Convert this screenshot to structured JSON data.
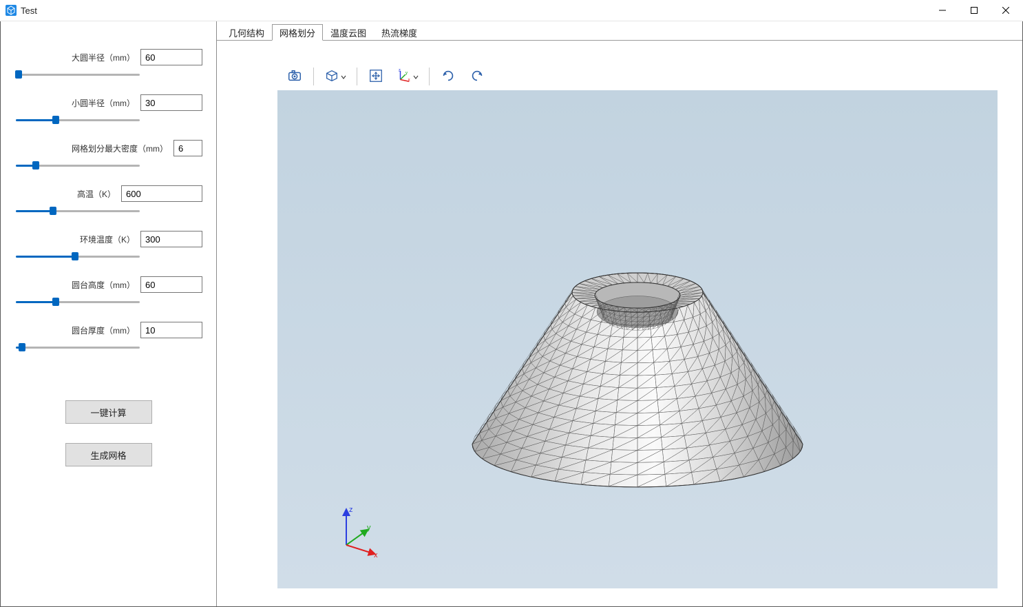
{
  "window": {
    "title": "Test"
  },
  "params": [
    {
      "label": "大圆半径（mm）",
      "value": "60",
      "input_w": "w90",
      "slider_pct": 2,
      "slider_w": 180
    },
    {
      "label": "小圆半径（mm）",
      "value": "30",
      "input_w": "w90",
      "slider_pct": 32,
      "slider_w": 180
    },
    {
      "label": "网格划分最大密度（mm）",
      "value": "6",
      "input_w": "w42",
      "slider_pct": 16,
      "slider_w": 180
    },
    {
      "label": "高温（K）",
      "value": "600",
      "input_w": "w118",
      "slider_pct": 30,
      "slider_w": 180
    },
    {
      "label": "环境温度（K）",
      "value": "300",
      "input_w": "w90",
      "slider_pct": 48,
      "slider_w": 180
    },
    {
      "label": "圆台高度（mm）",
      "value": "60",
      "input_w": "w90",
      "slider_pct": 32,
      "slider_w": 180
    },
    {
      "label": "圆台厚度（mm）",
      "value": "10",
      "input_w": "w90",
      "slider_pct": 5,
      "slider_w": 180
    }
  ],
  "actions": {
    "compute": "一键计算",
    "generate_mesh": "生成网格"
  },
  "tabs": [
    {
      "label": "几何结构",
      "active": false
    },
    {
      "label": "网格划分",
      "active": true
    },
    {
      "label": "温度云图",
      "active": false
    },
    {
      "label": "热流梯度",
      "active": false
    }
  ],
  "toolbar": {
    "items": [
      {
        "name": "camera-icon"
      },
      {
        "name": "sep"
      },
      {
        "name": "cube-icon",
        "dropdown": true
      },
      {
        "name": "sep"
      },
      {
        "name": "fit-icon"
      },
      {
        "name": "axes-icon",
        "dropdown": true
      },
      {
        "name": "sep"
      },
      {
        "name": "rotate-left-icon"
      },
      {
        "name": "rotate-right-icon"
      }
    ]
  },
  "triad": {
    "x": "x",
    "y": "y",
    "z": "z"
  }
}
